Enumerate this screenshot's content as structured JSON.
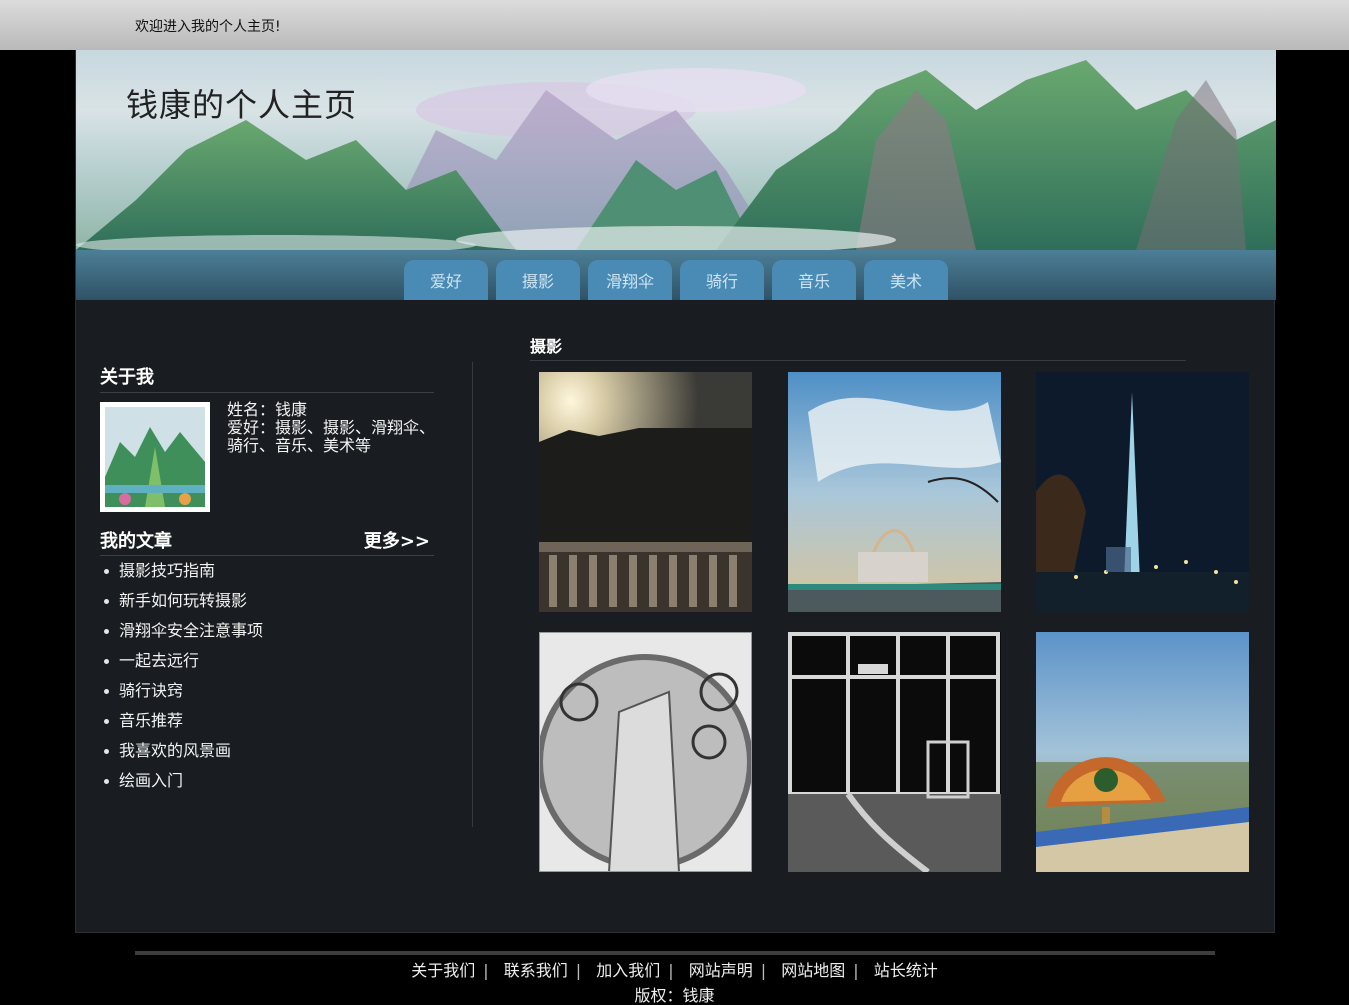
{
  "topbar": {
    "welcome": "欢迎进入我的个人主页!"
  },
  "banner": {
    "title": "钱康的个人主页"
  },
  "nav": {
    "tabs": [
      "爱好",
      "摄影",
      "滑翔伞",
      "骑行",
      "音乐",
      "美术"
    ]
  },
  "about": {
    "heading": "关于我",
    "name_line": "姓名：钱康",
    "hobby_line": "爱好：摄影、摄影、滑翔伞、骑行、音乐、美术等"
  },
  "articles": {
    "heading": "我的文章",
    "more": "更多>>",
    "items": [
      "摄影技巧指南",
      "新手如何玩转摄影",
      "滑翔伞安全注意事项",
      "一起去远行",
      "骑行诀窍",
      "音乐推荐",
      "我喜欢的风景画",
      "绘画入门"
    ]
  },
  "photos": {
    "heading": "摄影",
    "items": [
      "sunset-balcony-photo",
      "rainbow-bridge-photo",
      "night-spire-photo",
      "bicycle-fisheye-photo",
      "glass-door-photo",
      "tiffany-lamp-photo"
    ]
  },
  "footer": {
    "links": [
      "关于我们",
      "联系我们",
      "加入我们",
      "网站声明",
      "网站地图",
      "站长统计"
    ],
    "copyright": "版权：钱康"
  }
}
